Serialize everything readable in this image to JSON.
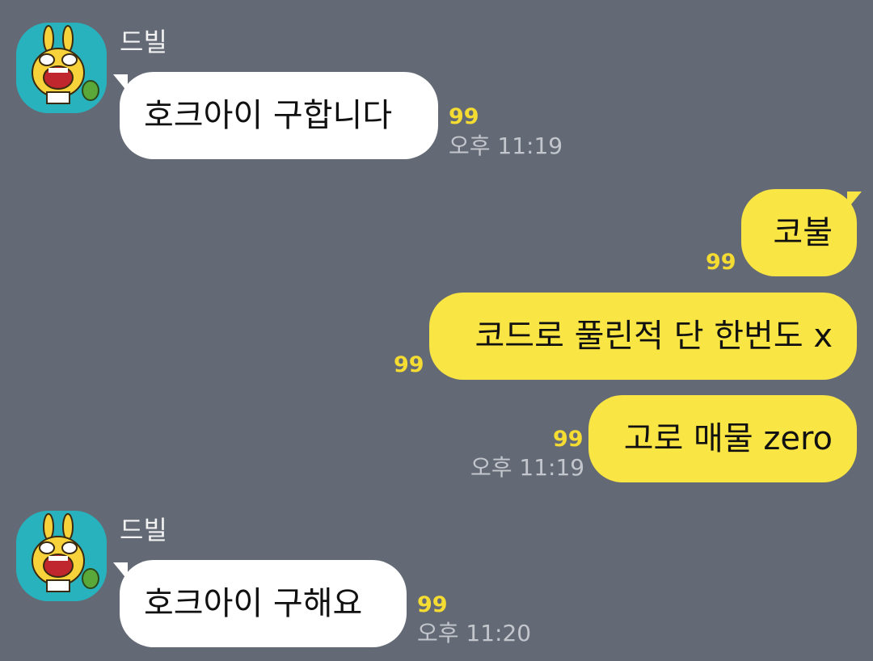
{
  "messages": {
    "m1": {
      "sender": "드빌",
      "text": "호크아이 구합니다",
      "unread": "99",
      "time": "오후 11:19"
    },
    "m2": {
      "text": "코불",
      "unread": "99"
    },
    "m3": {
      "text": "코드로 풀린적 단 한번도 x",
      "unread": "99"
    },
    "m4": {
      "text": "고로 매물 zero",
      "unread": "99",
      "time": "오후 11:19"
    },
    "m5": {
      "sender": "드빌",
      "text": "호크아이 구해요",
      "unread": "99",
      "time": "오후 11:20"
    }
  },
  "colors": {
    "background": "#646a75",
    "outgoing_bubble": "#f9e543",
    "incoming_bubble": "#ffffff",
    "unread_count": "#f5dc32",
    "avatar_bg": "#28b2bd"
  },
  "icons": {
    "avatar": "yellow-rabbit-character-avatar-icon"
  }
}
